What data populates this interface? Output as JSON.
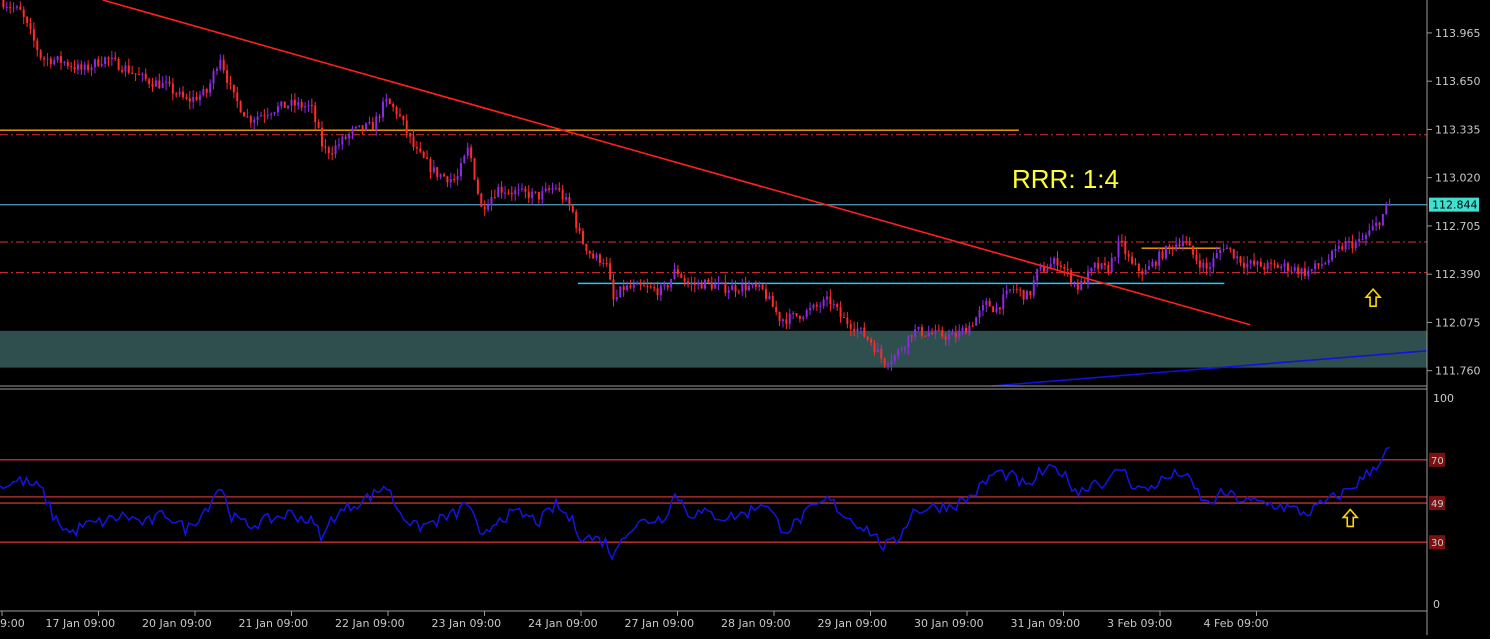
{
  "chart_data": [
    {
      "type": "candlestick",
      "instrument_panel": "price",
      "y_ticks": [
        "113.965",
        "113.650",
        "113.335",
        "113.020",
        "112.705",
        "112.390",
        "112.075",
        "111.760"
      ],
      "ylim": [
        111.66,
        114.18
      ],
      "current_price": "112.844",
      "x_labels": [
        "9:00",
        "17 Jan 09:00",
        "20 Jan 09:00",
        "21 Jan 09:00",
        "22 Jan 09:00",
        "23 Jan 09:00",
        "24 Jan 09:00",
        "27 Jan 09:00",
        "28 Jan 09:00",
        "29 Jan 09:00",
        "30 Jan 09:00",
        "31 Jan 09:00",
        "3 Feb 09:00",
        "4 Feb 09:00"
      ],
      "close_path": [
        [
          0,
          114.18
        ],
        [
          0.5,
          114.1
        ],
        [
          1,
          113.8
        ],
        [
          1.5,
          113.78
        ],
        [
          2,
          113.72
        ],
        [
          2.5,
          113.8
        ],
        [
          3,
          113.74
        ],
        [
          3.5,
          113.66
        ],
        [
          4,
          113.62
        ],
        [
          4.5,
          113.52
        ],
        [
          5,
          113.58
        ],
        [
          5.3,
          113.82
        ],
        [
          5.6,
          113.56
        ],
        [
          6,
          113.4
        ],
        [
          6.5,
          113.46
        ],
        [
          7,
          113.5
        ],
        [
          7.5,
          113.48
        ],
        [
          7.8,
          113.2
        ],
        [
          8,
          113.2
        ],
        [
          8.5,
          113.32
        ],
        [
          9,
          113.36
        ],
        [
          9.3,
          113.52
        ],
        [
          9.6,
          113.44
        ],
        [
          10,
          113.2
        ],
        [
          10.5,
          113.05
        ],
        [
          11,
          113.0
        ],
        [
          11.3,
          113.22
        ],
        [
          11.6,
          112.82
        ],
        [
          12,
          112.95
        ],
        [
          12.5,
          112.92
        ],
        [
          13,
          112.9
        ],
        [
          13.4,
          112.96
        ],
        [
          13.8,
          112.8
        ],
        [
          14,
          112.62
        ],
        [
          14.3,
          112.5
        ],
        [
          14.6,
          112.48
        ],
        [
          14.8,
          112.2
        ],
        [
          15,
          112.3
        ],
        [
          15.5,
          112.3
        ],
        [
          16,
          112.28
        ],
        [
          16.3,
          112.42
        ],
        [
          16.6,
          112.32
        ],
        [
          17,
          112.33
        ],
        [
          17.5,
          112.3
        ],
        [
          18,
          112.31
        ],
        [
          18.4,
          112.28
        ],
        [
          18.8,
          112.1
        ],
        [
          19,
          112.1
        ],
        [
          19.5,
          112.15
        ],
        [
          20,
          112.22
        ],
        [
          20.3,
          112.1
        ],
        [
          20.6,
          112.05
        ],
        [
          21,
          111.95
        ],
        [
          21.3,
          111.82
        ],
        [
          21.6,
          111.86
        ],
        [
          22,
          112.02
        ],
        [
          22.5,
          112.0
        ],
        [
          23,
          111.98
        ],
        [
          23.4,
          112.06
        ],
        [
          23.8,
          112.2
        ],
        [
          24,
          112.16
        ],
        [
          24.4,
          112.3
        ],
        [
          24.8,
          112.24
        ],
        [
          25,
          112.4
        ],
        [
          25.5,
          112.48
        ],
        [
          26,
          112.3
        ],
        [
          26.4,
          112.44
        ],
        [
          26.7,
          112.42
        ],
        [
          27,
          112.6
        ],
        [
          27.3,
          112.44
        ],
        [
          27.6,
          112.4
        ],
        [
          28,
          112.52
        ],
        [
          28.5,
          112.62
        ],
        [
          28.8,
          112.5
        ],
        [
          29.1,
          112.42
        ],
        [
          29.5,
          112.58
        ],
        [
          30,
          112.46
        ],
        [
          30.5,
          112.44
        ],
        [
          31,
          112.44
        ],
        [
          31.5,
          112.4
        ],
        [
          32,
          112.48
        ],
        [
          32.4,
          112.58
        ],
        [
          32.8,
          112.6
        ],
        [
          33.2,
          112.72
        ],
        [
          33.5,
          112.844
        ]
      ],
      "horizontal_lines": [
        {
          "price": 113.33,
          "style": "solid",
          "color": "#ffa500",
          "x_end": 0.714
        },
        {
          "price": 113.3,
          "style": "dash-dot",
          "color": "#e03030",
          "x_end": 1.0
        },
        {
          "price": 112.6,
          "style": "dash-dot",
          "color": "#e03030",
          "x_end": 1.0
        },
        {
          "price": 112.4,
          "style": "dash-dot",
          "color": "#e03030",
          "x_end": 1.0
        },
        {
          "price": 112.33,
          "style": "solid",
          "color": "#1ec8ff",
          "x_start": 0.405,
          "x_end": 0.858
        },
        {
          "price": 112.56,
          "style": "solid",
          "color": "#ffa500",
          "x_start": 0.8,
          "x_end": 0.855
        },
        {
          "price": 112.844,
          "style": "solid",
          "color": "#4a8ea8",
          "x_end": 1.0
        }
      ],
      "trendlines": [
        {
          "color": "#ff2020",
          "from": [
            0.072,
            114.18
          ],
          "to": [
            0.876,
            112.06
          ]
        },
        {
          "color": "#1010e0",
          "from": [
            0.695,
            111.66
          ],
          "to": [
            1.0,
            111.89
          ]
        }
      ],
      "zone": {
        "from": 111.78,
        "to": 112.02,
        "color": "#2f4f4f"
      },
      "annotations": [
        {
          "text": "RRR: 1:4",
          "color": "#ffff33"
        }
      ],
      "arrows": [
        {
          "dir": "up",
          "at_x": 33.1,
          "at_y": 112.24
        }
      ]
    },
    {
      "type": "line",
      "instrument_panel": "oscillator",
      "ylim": [
        0,
        100
      ],
      "y_ticks": [
        "100",
        "0"
      ],
      "levels": [
        {
          "value": 70,
          "label": "70"
        },
        {
          "value": 52,
          "label": ""
        },
        {
          "value": 49,
          "label": "49"
        },
        {
          "value": 30,
          "label": "30"
        }
      ],
      "series": [
        {
          "color": "#1414e6",
          "values": [
            [
              0,
              57
            ],
            [
              0.5,
              60
            ],
            [
              1,
              56
            ],
            [
              1.3,
              42
            ],
            [
              1.7,
              34
            ],
            [
              2,
              38
            ],
            [
              2.5,
              40
            ],
            [
              3,
              43
            ],
            [
              3.5,
              39
            ],
            [
              4,
              44
            ],
            [
              4.5,
              36
            ],
            [
              5,
              47
            ],
            [
              5.3,
              58
            ],
            [
              5.6,
              42
            ],
            [
              6,
              38
            ],
            [
              6.5,
              41
            ],
            [
              7,
              44
            ],
            [
              7.5,
              40
            ],
            [
              7.8,
              32
            ],
            [
              8,
              42
            ],
            [
              8.5,
              48
            ],
            [
              9,
              53
            ],
            [
              9.3,
              58
            ],
            [
              9.6,
              46
            ],
            [
              10,
              37
            ],
            [
              10.5,
              40
            ],
            [
              11,
              44
            ],
            [
              11.3,
              50
            ],
            [
              11.6,
              30
            ],
            [
              12,
              42
            ],
            [
              12.5,
              44
            ],
            [
              13,
              40
            ],
            [
              13.4,
              48
            ],
            [
              13.8,
              40
            ],
            [
              14,
              33
            ],
            [
              14.3,
              32
            ],
            [
              14.6,
              30
            ],
            [
              14.8,
              22
            ],
            [
              15,
              34
            ],
            [
              15.5,
              40
            ],
            [
              16,
              42
            ],
            [
              16.3,
              54
            ],
            [
              16.6,
              44
            ],
            [
              17,
              44
            ],
            [
              17.5,
              42
            ],
            [
              18,
              44
            ],
            [
              18.4,
              50
            ],
            [
              18.8,
              38
            ],
            [
              19,
              36
            ],
            [
              19.5,
              45
            ],
            [
              20,
              51
            ],
            [
              20.3,
              44
            ],
            [
              20.6,
              40
            ],
            [
              21,
              35
            ],
            [
              21.3,
              28
            ],
            [
              21.6,
              30
            ],
            [
              22,
              45
            ],
            [
              22.5,
              47
            ],
            [
              23,
              48
            ],
            [
              23.4,
              52
            ],
            [
              23.8,
              60
            ],
            [
              24,
              64
            ],
            [
              24.4,
              62
            ],
            [
              24.8,
              56
            ],
            [
              25,
              63
            ],
            [
              25.5,
              66
            ],
            [
              26,
              54
            ],
            [
              26.4,
              60
            ],
            [
              26.7,
              58
            ],
            [
              27,
              67
            ],
            [
              27.3,
              58
            ],
            [
              27.6,
              55
            ],
            [
              28,
              60
            ],
            [
              28.5,
              64
            ],
            [
              28.8,
              56
            ],
            [
              29.1,
              48
            ],
            [
              29.5,
              54
            ],
            [
              30,
              50
            ],
            [
              30.5,
              49
            ],
            [
              31,
              47
            ],
            [
              31.5,
              44
            ],
            [
              32,
              50
            ],
            [
              32.4,
              54
            ],
            [
              32.8,
              60
            ],
            [
              33.2,
              68
            ],
            [
              33.5,
              76
            ]
          ]
        }
      ],
      "arrows": [
        {
          "dir": "up",
          "at_x": 32.55,
          "at_y": 42
        }
      ]
    }
  ]
}
